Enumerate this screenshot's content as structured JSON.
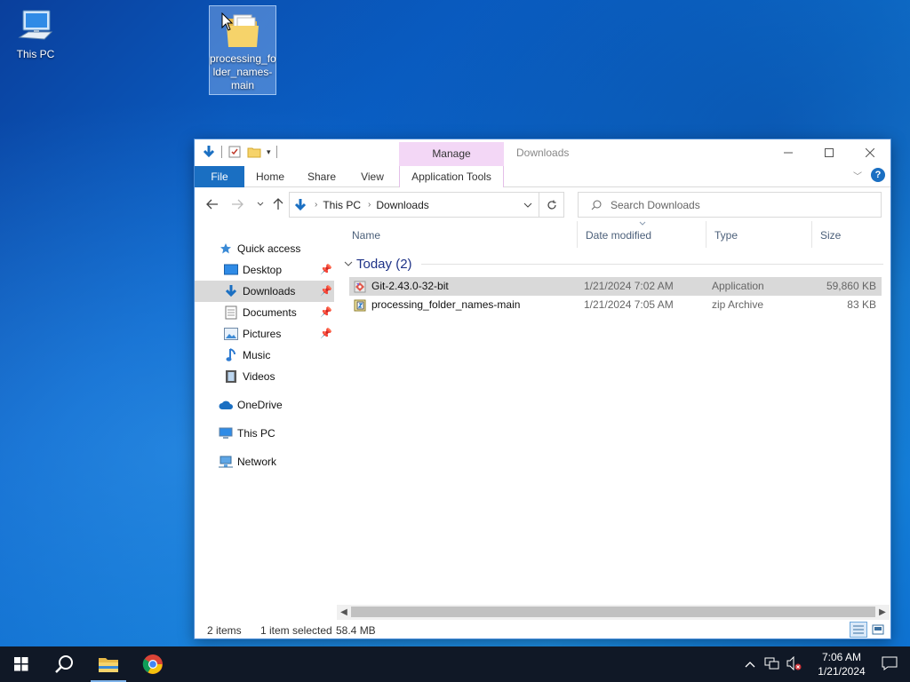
{
  "desktop": {
    "icons": [
      {
        "label": "This PC"
      },
      {
        "label": "processing_fo lder_names- main"
      }
    ]
  },
  "window": {
    "title": "Downloads",
    "contextual_tab": "Manage",
    "ribbon_tabs": [
      "File",
      "Home",
      "Share",
      "View",
      "Application Tools"
    ],
    "address": {
      "crumbs": [
        "This PC",
        "Downloads"
      ]
    },
    "search": {
      "placeholder": "Search Downloads"
    },
    "nav_pane": {
      "quick_access": "Quick access",
      "items": [
        {
          "label": "Desktop",
          "pinned": true
        },
        {
          "label": "Downloads",
          "pinned": true,
          "selected": true
        },
        {
          "label": "Documents",
          "pinned": true
        },
        {
          "label": "Pictures",
          "pinned": true
        },
        {
          "label": "Music",
          "pinned": false
        },
        {
          "label": "Videos",
          "pinned": false
        }
      ],
      "onedrive": "OneDrive",
      "thispc": "This PC",
      "network": "Network"
    },
    "columns": [
      "Name",
      "Date modified",
      "Type",
      "Size"
    ],
    "group": {
      "title": "Today (2)"
    },
    "files": [
      {
        "name": "Git-2.43.0-32-bit",
        "date": "1/21/2024 7:02 AM",
        "type": "Application",
        "size": "59,860 KB",
        "selected": true
      },
      {
        "name": "processing_folder_names-main",
        "date": "1/21/2024 7:05 AM",
        "type": "zip Archive",
        "size": "83 KB",
        "selected": false
      }
    ],
    "status": {
      "count": "2 items",
      "selection": "1 item selected",
      "selection_size": "58.4 MB"
    }
  },
  "taskbar": {
    "time": "7:06 AM",
    "date": "1/21/2024"
  },
  "colors": {
    "accent": "#1a6fc2",
    "manage_tab": "#f3d7f6",
    "selection": "#d9d9d9",
    "taskbar": "#101826"
  }
}
